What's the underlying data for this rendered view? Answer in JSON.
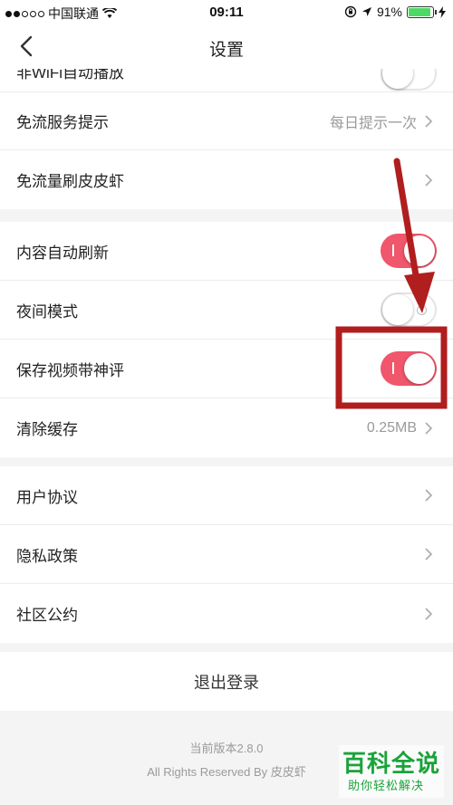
{
  "status_bar": {
    "carrier": "中国联通",
    "time": "09:11",
    "battery": "91%",
    "battery_level": 0.91
  },
  "nav": {
    "title": "设置",
    "back_icon": "chevron-left-icon"
  },
  "partial_row": {
    "label": "非WiFi自动播放"
  },
  "group1": {
    "free_flow_tip": {
      "label": "免流服务提示",
      "value": "每日提示一次"
    },
    "free_flow_brush": {
      "label": "免流量刷皮皮虾"
    }
  },
  "group2": {
    "auto_refresh": {
      "label": "内容自动刷新",
      "on": true
    },
    "night_mode": {
      "label": "夜间模式",
      "on": false
    },
    "save_video_comment": {
      "label": "保存视频带神评",
      "on": true
    },
    "clear_cache": {
      "label": "清除缓存",
      "value": "0.25MB"
    }
  },
  "group3": {
    "user_agreement": {
      "label": "用户协议"
    },
    "privacy_policy": {
      "label": "隐私政策"
    },
    "community_rules": {
      "label": "社区公约"
    }
  },
  "logout": {
    "label": "退出登录"
  },
  "footer": {
    "version": "当前版本2.8.0",
    "rights": "All Rights Reserved By 皮皮虾"
  },
  "watermark": {
    "title": "百科全说",
    "subtitle": "助你轻松解决"
  },
  "colors": {
    "toggle_on": "#f0566c",
    "annotation": "#b01e1e",
    "watermark": "#1aa33a"
  }
}
